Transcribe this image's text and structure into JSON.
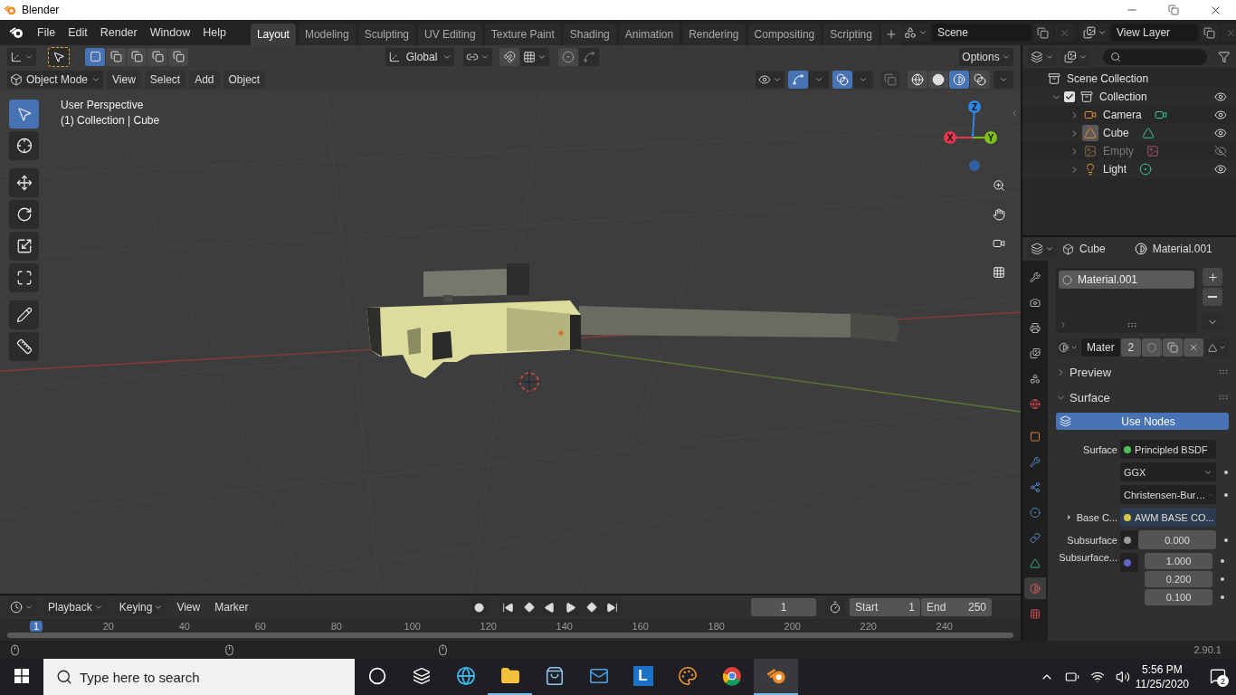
{
  "window": {
    "title": "Blender"
  },
  "menus": [
    "File",
    "Edit",
    "Render",
    "Window",
    "Help"
  ],
  "workspaces": [
    {
      "label": "Layout",
      "selected": true
    },
    {
      "label": "Modeling",
      "selected": false
    },
    {
      "label": "Sculpting",
      "selected": false
    },
    {
      "label": "UV Editing",
      "selected": false
    },
    {
      "label": "Texture Paint",
      "selected": false
    },
    {
      "label": "Shading",
      "selected": false
    },
    {
      "label": "Animation",
      "selected": false
    },
    {
      "label": "Rendering",
      "selected": false
    },
    {
      "label": "Compositing",
      "selected": false
    },
    {
      "label": "Scripting",
      "selected": false
    }
  ],
  "scene": {
    "value": "Scene"
  },
  "view_layer": {
    "value": "View Layer"
  },
  "tool_header": {
    "select_modes": [
      {
        "selected": true
      },
      {
        "selected": false
      },
      {
        "selected": false
      },
      {
        "selected": false
      },
      {
        "selected": false
      }
    ],
    "orientation": "Global",
    "options": "Options"
  },
  "viewport_header": {
    "mode": "Object Mode",
    "menus": [
      "View",
      "Select",
      "Add",
      "Object"
    ],
    "gizmos_on": true,
    "overlays_on": true,
    "shading": [
      {
        "kind": "wireframe",
        "selected": false
      },
      {
        "kind": "solid",
        "selected": false
      },
      {
        "kind": "material",
        "selected": true
      },
      {
        "kind": "rendered",
        "selected": false
      }
    ]
  },
  "viewport": {
    "info": [
      "User Perspective",
      "(1) Collection | Cube"
    ],
    "tools": [
      {
        "kind": "select",
        "selected": true
      },
      {
        "kind": "cursor",
        "selected": false
      },
      {
        "kind": "move",
        "selected": false
      },
      {
        "kind": "rotate",
        "selected": false
      },
      {
        "kind": "scale",
        "selected": false
      },
      {
        "kind": "transform",
        "selected": false
      },
      {
        "kind": "annotate",
        "selected": false
      },
      {
        "kind": "measure",
        "selected": false
      }
    ],
    "axes": [
      {
        "label": "X",
        "color": "#e4384f"
      },
      {
        "label": "Y",
        "color": "#7fbf1c"
      },
      {
        "label": "Z",
        "color": "#2f86e0"
      }
    ]
  },
  "outliner": {
    "root": {
      "label": "Scene Collection",
      "children": [
        {
          "label": "Collection",
          "checked": true,
          "expanded": true,
          "visible": true,
          "children": [
            {
              "label": "Camera",
              "kind": "camera",
              "expanded": false,
              "selected": false,
              "visible": true
            },
            {
              "label": "Cube",
              "kind": "mesh",
              "expanded": false,
              "selected": true,
              "visible": true
            },
            {
              "label": "Empty",
              "kind": "empty",
              "expanded": false,
              "selected": false,
              "visible": false
            },
            {
              "label": "Light",
              "kind": "light",
              "expanded": false,
              "selected": false,
              "visible": true
            }
          ]
        }
      ]
    }
  },
  "properties": {
    "object": "Cube",
    "material": "Material.001",
    "tabs": [
      {
        "kind": "tool",
        "selected": false
      },
      {
        "kind": "render",
        "selected": false
      },
      {
        "kind": "output",
        "selected": false
      },
      {
        "kind": "view_layer",
        "selected": false
      },
      {
        "kind": "scene",
        "selected": false
      },
      {
        "kind": "world",
        "selected": false
      },
      {
        "kind": "object",
        "selected": false
      },
      {
        "kind": "modifier",
        "selected": false
      },
      {
        "kind": "particles",
        "selected": false
      },
      {
        "kind": "physics",
        "selected": false
      },
      {
        "kind": "constraints",
        "selected": false
      },
      {
        "kind": "data",
        "selected": false
      },
      {
        "kind": "material",
        "selected": true
      },
      {
        "kind": "texture",
        "selected": false
      }
    ],
    "slots": [
      {
        "label": "Material.001",
        "selected": true
      }
    ],
    "material_field": "Mater",
    "users": "2",
    "sections": [
      {
        "label": "Preview",
        "expanded": false
      },
      {
        "label": "Surface",
        "expanded": true
      }
    ],
    "use_nodes": "Use Nodes",
    "inputs": [
      {
        "kind": "link",
        "label": "Surface",
        "value": "Principled BSDF",
        "color": "#4fbf5a",
        "expandable": false
      },
      {
        "kind": "dropdown",
        "value": "GGX"
      },
      {
        "kind": "dropdown",
        "value": "Christensen-Bur…"
      },
      {
        "kind": "link",
        "label": "Base C...",
        "value": "AWM BASE CO...",
        "color": "#d2c948",
        "expandable": true
      },
      {
        "kind": "number",
        "label": "Subsurface",
        "value": "0.000",
        "color": "#9a9a9a",
        "expandable": false
      },
      {
        "kind": "vector",
        "label": "Subsurface...",
        "values": [
          "1.000",
          "0.200",
          "0.100"
        ],
        "color": "#6464c8",
        "expandable": false
      }
    ]
  },
  "timeline": {
    "menus": [
      "Playback",
      "Keying",
      "View",
      "Marker"
    ],
    "current_frame": "1",
    "start_label": "Start",
    "start": "1",
    "end_label": "End",
    "end": "250",
    "ruler": [
      {
        "label": "1",
        "selected": true
      },
      {
        "label": "20",
        "selected": false
      },
      {
        "label": "40",
        "selected": false
      },
      {
        "label": "60",
        "selected": false
      },
      {
        "label": "80",
        "selected": false
      },
      {
        "label": "100",
        "selected": false
      },
      {
        "label": "120",
        "selected": false
      },
      {
        "label": "140",
        "selected": false
      },
      {
        "label": "160",
        "selected": false
      },
      {
        "label": "180",
        "selected": false
      },
      {
        "label": "200",
        "selected": false
      },
      {
        "label": "220",
        "selected": false
      },
      {
        "label": "240",
        "selected": false
      }
    ]
  },
  "status_bar": {
    "version": "2.90.1"
  },
  "taskbar": {
    "search": {
      "placeholder": "Type here to search"
    },
    "apps": [
      {
        "kind": "cortana",
        "selected": false,
        "running": false
      },
      {
        "kind": "taskview",
        "selected": false,
        "running": false
      },
      {
        "kind": "edge",
        "selected": false,
        "running": false
      },
      {
        "kind": "explorer",
        "selected": false,
        "running": true
      },
      {
        "kind": "store",
        "selected": false,
        "running": false
      },
      {
        "kind": "mail",
        "selected": false,
        "running": false
      },
      {
        "kind": "letter",
        "label": "L",
        "selected": false,
        "running": false
      },
      {
        "kind": "paint",
        "selected": false,
        "running": false
      },
      {
        "kind": "chrome",
        "selected": false,
        "running": false
      },
      {
        "kind": "blender",
        "selected": true,
        "running": true
      }
    ],
    "time": "5:56 PM",
    "date": "11/25/2020",
    "notifications": "2"
  }
}
